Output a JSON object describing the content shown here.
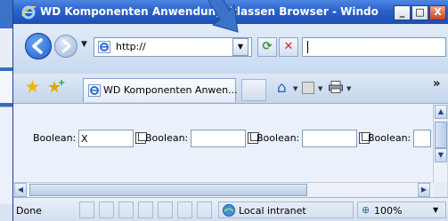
{
  "window": {
    "title": "WD Komponenten Anwendungsklassen Browser - Windows Inter...",
    "minimize_glyph": "_",
    "maximize_glyph": "□",
    "close_glyph": "X"
  },
  "address_bar": {
    "url": "http://",
    "search_value": ""
  },
  "tab": {
    "label": "WD Komponenten Anwen..."
  },
  "toolbar": {
    "more_glyph": "»"
  },
  "content": {
    "fields": [
      {
        "label": "Boolean:",
        "value": "X"
      },
      {
        "label": "Boolean:",
        "value": ""
      },
      {
        "label": "Boolean:",
        "value": ""
      },
      {
        "label": "Boolean:",
        "value": ""
      }
    ]
  },
  "status": {
    "text": "Done",
    "zone": "Local intranet",
    "zoom": "100%"
  },
  "colors": {
    "titlebar": "#2a62cd",
    "content_bg": "#eaf1fb",
    "pointer": "#3a73c8"
  },
  "icons": [
    "back-icon",
    "forward-icon",
    "ie-page-icon",
    "refresh-icon",
    "stop-icon",
    "favorites-star-icon",
    "add-favorites-icon",
    "home-icon",
    "feeds-icon",
    "print-icon",
    "field-picker-icon",
    "intranet-icon",
    "zoom-icon"
  ]
}
